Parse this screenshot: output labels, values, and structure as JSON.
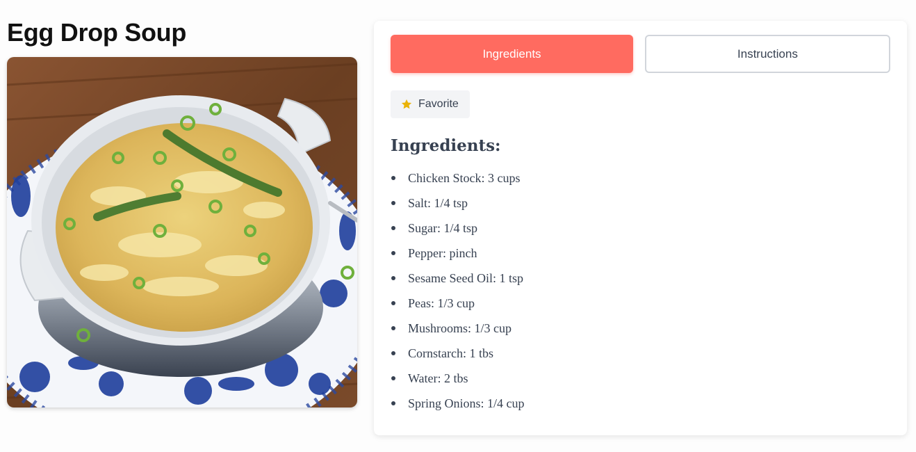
{
  "recipe": {
    "title": "Egg Drop Soup",
    "image_alt": "Egg Drop Soup"
  },
  "tabs": [
    {
      "label": "Ingredients",
      "active": true
    },
    {
      "label": "Instructions",
      "active": false
    }
  ],
  "favorite": {
    "label": "Favorite",
    "icon": "star-icon",
    "icon_color": "#eab308"
  },
  "ingredients": {
    "heading": "Ingredients:",
    "items": [
      "Chicken Stock: 3 cups",
      "Salt: 1/4 tsp",
      "Sugar: 1/4 tsp",
      "Pepper: pinch",
      "Sesame Seed Oil: 1 tsp",
      "Peas: 1/3 cup",
      "Mushrooms: 1/3 cup",
      "Cornstarch: 1 tbs",
      "Water: 2 tbs",
      "Spring Onions: 1/4 cup"
    ]
  },
  "colors": {
    "accent": "#ff6b60",
    "text": "#374151",
    "card_bg": "#ffffff",
    "button_bg": "#f3f4f6"
  }
}
